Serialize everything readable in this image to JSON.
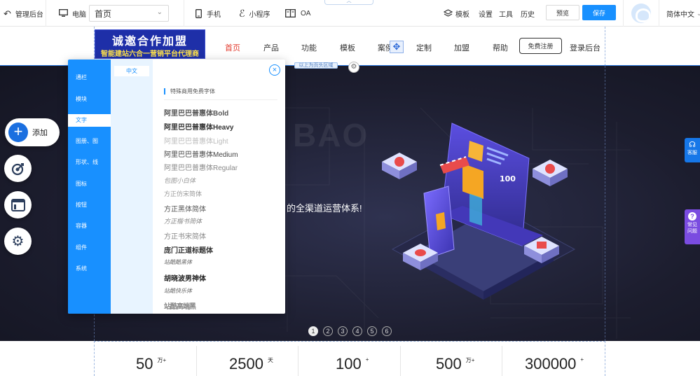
{
  "toolbar": {
    "back_label": "管理后台",
    "desktop_label": "电脑",
    "page_select": "首页",
    "mobile_label": "手机",
    "miniprogram_label": "小程序",
    "oa_label": "OA",
    "template_label": "模板",
    "settings_label": "设置",
    "tools_label": "工具",
    "history_label": "历史",
    "preview_label": "预览",
    "save_label": "保存",
    "language_label": "简体中文"
  },
  "site_header": {
    "logo_line1": "诚邀合作加盟",
    "logo_line2": "智能建站六合一营销平台代理商",
    "nav": [
      "首页",
      "产品",
      "功能",
      "模板",
      "案例",
      "定制",
      "加盟",
      "帮助"
    ],
    "register_label": "免费注册",
    "login_label": "登录后台",
    "header_area_tag": "以上为页头区域"
  },
  "banner": {
    "bg_text": "BAO",
    "caption": "的全渠道运营体系!",
    "pages": [
      "1",
      "2",
      "3",
      "4",
      "5",
      "6"
    ],
    "active_page": 1,
    "illustration_badge": "100"
  },
  "stats": [
    {
      "value": "50",
      "unit": "万+"
    },
    {
      "value": "2500",
      "unit": "天"
    },
    {
      "value": "100",
      "unit": "+"
    },
    {
      "value": "500",
      "unit": "万+"
    },
    {
      "value": "300000",
      "unit": "+"
    }
  ],
  "left_tools": {
    "add_label": "添加"
  },
  "side_tabs": {
    "service_label": "客服",
    "faq_label": "常见问题"
  },
  "panel": {
    "categories": [
      "通栏",
      "模块",
      "文字",
      "图册、图",
      "形状、线",
      "图标",
      "按钮",
      "容器",
      "组件",
      "系统"
    ],
    "active_category": "文字",
    "sub_tab": "中文",
    "section_title": "特殊商用免费字体",
    "fonts": [
      "阿里巴巴普惠体Bold",
      "阿里巴巴普惠体Heavy",
      "阿里巴巴普惠体Light",
      "阿里巴巴普惠体Medium",
      "阿里巴巴普惠体Regular",
      "包图小白体",
      "方正仿宋简体",
      "方正黑体简体",
      "方正楷书简体",
      "方正书宋简体",
      "庞门正道标题体",
      "站酷酷黑体",
      "胡晓波男神体",
      "站酷快乐体",
      "站酷高端黑"
    ]
  }
}
